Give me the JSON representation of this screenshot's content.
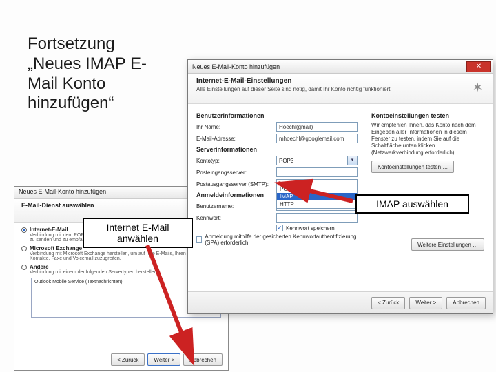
{
  "slide": {
    "title": "Fortsetzung „Neues IMAP E-Mail Konto hinzufügen“"
  },
  "callouts": {
    "imap": "IMAP auswählen",
    "inet": "Internet E-Mail anwählen"
  },
  "dlg_back": {
    "title": "Neues E-Mail-Konto hinzufügen",
    "banner": "E-Mail-Dienst auswählen",
    "opt_internet": {
      "label": "Internet-E-Mail",
      "desc": "Verbindung mit dem POP-, IMAP- oder HTTP-Server herstellen, um E-Mail-Nachrichten zu senden und zu empfangen."
    },
    "opt_exchange": {
      "label": "Microsoft Exchange",
      "desc": "Verbindung mit Microsoft Exchange herstellen, um auf Ihre E-Mails, Ihren Kalender, Kontakte, Faxe und Voicemail zuzugreifen."
    },
    "opt_other": {
      "label": "Andere",
      "desc": "Verbindung mit einem der folgenden Servertypen herstellen."
    },
    "listbox_item": "Outlook Mobile Service (Textnachrichten)",
    "buttons": {
      "back": "< Zurück",
      "next": "Weiter >",
      "cancel": "Abbrechen"
    }
  },
  "dlg_main": {
    "title": "Neues E-Mail-Konto hinzufügen",
    "banner_h": "Internet-E-Mail-Einstellungen",
    "banner_d": "Alle Einstellungen auf dieser Seite sind nötig, damit Ihr Konto richtig funktioniert.",
    "sections": {
      "user": "Benutzerinformationen",
      "server": "Serverinformationen",
      "login": "Anmeldeinformationen",
      "test": "Kontoeinstellungen testen"
    },
    "labels": {
      "name": "Ihr Name:",
      "email": "E-Mail-Adresse:",
      "type": "Kontotyp:",
      "incoming": "Posteingangsserver:",
      "outgoing": "Postausgangsserver (SMTP):",
      "user": "Benutzername:",
      "pass": "Kennwort:"
    },
    "values": {
      "name": "Hoechl(gmail)",
      "email": "mhoechl@googlemail.com",
      "type_selected": "POP3",
      "user": "",
      "pass": ""
    },
    "dropdown": [
      "POP3",
      "IMAP",
      "HTTP"
    ],
    "chk_savepw": "Kennwort speichern",
    "chk_spa": "Anmeldung mithilfe der gesicherten Kennwortauthentifizierung (SPA) erforderlich",
    "test_note": "Wir empfehlen Ihnen, das Konto nach dem Eingeben aller Informationen in diesem Fenster zu testen, indem Sie auf die Schaltfläche unten klicken (Netzwerkverbindung erforderlich).",
    "btn_test": "Kontoeinstellungen testen …",
    "btn_more": "Weitere Einstellungen …",
    "buttons": {
      "back": "< Zurück",
      "next": "Weiter >",
      "cancel": "Abbrechen"
    }
  }
}
